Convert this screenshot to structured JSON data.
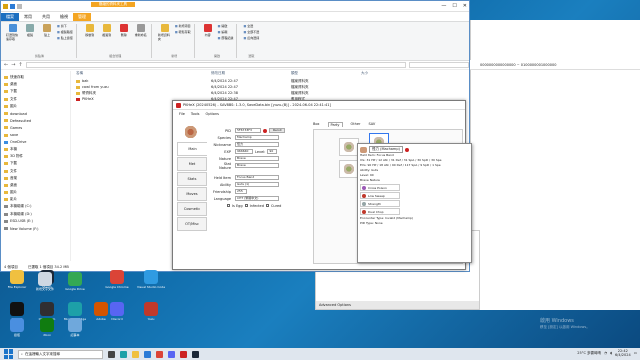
{
  "explorer": {
    "title": "",
    "tabs": {
      "file": "檔案",
      "home": "常用",
      "share": "共用",
      "view": "檢視",
      "manage": "管理",
      "context_title": "壓縮的資料夾工具"
    },
    "ribbon": {
      "pin_label": "釘選到快速存取",
      "copy_label": "複製",
      "paste_label": "貼上",
      "cut_label": "剪下",
      "copy_path_label": "複製路徑",
      "paste_shortcut_label": "貼上捷徑",
      "move_to_label": "移動到",
      "copy_to_label": "複製到",
      "delete_label": "刪除",
      "rename_label": "重新命名",
      "new_folder_label": "新增資料夾",
      "new_item_label": "新增項目",
      "easy_access_label": "輕鬆存取",
      "properties_label": "內容",
      "open_label": "開啟",
      "edit_label": "編輯",
      "history_label": "歷程記錄",
      "select_all_label": "全選",
      "select_none_label": "全部不選",
      "invert_label": "反向選擇",
      "group_clipboard": "剪貼簿",
      "group_organize": "組合管理",
      "group_new": "新增",
      "group_open": "開啟",
      "group_select": "選取"
    },
    "address": "",
    "search_placeholder": "",
    "nav_pane": [
      "快速存取",
      "桌面",
      "下載",
      "文件",
      "圖片",
      "download",
      "Defeasulted",
      "Games",
      "save",
      "OneDrive",
      "本機",
      "3D 物件",
      "下載",
      "文件",
      "音樂",
      "桌面",
      "圖片",
      "影片",
      "本機磁碟 (C:)",
      "本機磁碟 (D:)",
      "ESD-USB (E:)",
      "New Volume (F:)"
    ],
    "columns": {
      "name": "名稱",
      "date": "修改日期",
      "type": "類型",
      "size": "大小"
    },
    "files": [
      {
        "name": "bak",
        "date": "6/4/2024 22:47",
        "type": "檔案資料夾"
      },
      {
        "name": "cawl from yuzu",
        "date": "6/4/2024 22:47",
        "type": "檔案資料夾"
      },
      {
        "name": "帶資料夾",
        "date": "6/4/2024 22:38",
        "type": "檔案資料夾"
      },
      {
        "name": "PKHeX",
        "date": "6/4/2024 22:47",
        "type": "應用程式"
      }
    ],
    "status_count": "4 個項目",
    "status_selected": "已選取 1 個項目 34.2 MB"
  },
  "bg_window": {
    "hex_text": "0000000000000000 ~ 0100000001000000"
  },
  "bg_window2": {
    "advanced": "Advanced Options"
  },
  "pkhex": {
    "title": "PKHeX (20240526) - SAV8BS: 1.3.0, SaveData.bin [yuzu-(B)] - 2024-06-04 22:41:41]",
    "menu": [
      "File",
      "Tools",
      "Options"
    ],
    "tabs": [
      "Main",
      "Met",
      "Stats",
      "Moves",
      "Cosmetic",
      "OT/Misc"
    ],
    "fields": {
      "pid_label": "PID",
      "pid_value": "5F6733F3",
      "reroll": "Reroll",
      "species_label": "Species",
      "species_value": "Machamp",
      "nickname_label": "Nickname",
      "nickname_value": "怪力",
      "exp_label": "EXP",
      "exp_value": "966640",
      "level_label": "Level:",
      "level_value": "90",
      "nature_label": "Nature",
      "nature_value": "Brave",
      "stat_nature_label": "Stat Nature",
      "stat_nature_value": "Brave",
      "held_item_label": "Held Item",
      "held_item_value": "Focus Band",
      "ability_label": "Ability",
      "ability_value": "Guts (1)",
      "friendship_label": "Friendship",
      "friendship_value": "255",
      "language_label": "Language",
      "language_value": "CHT (繁體中文)",
      "is_egg": "Is Egg",
      "infected": "Infected",
      "cured": "Cured"
    },
    "box_tabs": [
      "Box",
      "Party",
      "Other",
      "SAV"
    ]
  },
  "tooltip": {
    "name": "怪力 (Machamp)",
    "lines": [
      "Held Item: Focus Band",
      "IVs: 31 HP / 12 Atk / 31 Def / 31 SpA / 30 SpD / 30 Spe",
      "EVs: 90 HP / 18 Atk / 90 Def / 117 SpA / 9 SpD / 1 Spe",
      "Ability: Guts",
      "Level: 90",
      "Brave Nature"
    ],
    "moves": [
      "Cross Poison",
      "Low Sweep",
      "Strength",
      "Dual Chop"
    ],
    "encounter": "Encounter Type: Invalid (Machamp)",
    "pid_type": "PID Type: None"
  },
  "desktop_icons": [
    {
      "label": "File Explorer",
      "color": "#f0c040"
    },
    {
      "label": "Steam",
      "color": "#1b2838"
    },
    {
      "label": "Google Chrome",
      "color": "#db4437"
    },
    {
      "label": "Visual Studio Code",
      "color": "#2f9be2"
    },
    {
      "label": "CapCut",
      "color": "#111111"
    },
    {
      "label": "OBS Studio",
      "color": "#302e31"
    },
    {
      "label": "Microsoft Edge",
      "color": "#1da0a8"
    },
    {
      "label": "Discord",
      "color": "#5865f2"
    },
    {
      "label": "Yuzu",
      "color": "#c0392b"
    },
    {
      "label": "新增文字文件",
      "color": "#cfd8e3"
    },
    {
      "label": "Google Drive",
      "color": "#34a853"
    },
    {
      "label": "Adobe",
      "color": "#d35400"
    },
    {
      "label": "捷徑",
      "color": "#4a8fe0"
    },
    {
      "label": "Xbox",
      "color": "#107c10"
    },
    {
      "label": "記事本",
      "color": "#6fa8dc"
    }
  ],
  "taskbar": {
    "search_placeholder": "在這裡輸入文字來搜尋",
    "weather": "25°C 多雲時晴",
    "time": "22:42",
    "date": "6/4/2024"
  },
  "watermark": {
    "line1": "啟用 Windows",
    "line2": "移至 [設定] 以啟用 Windows。"
  },
  "colors": {
    "accent": "#1c6fc0",
    "manage_tab": "#f4a522",
    "desktop": "#0f6aa8"
  }
}
